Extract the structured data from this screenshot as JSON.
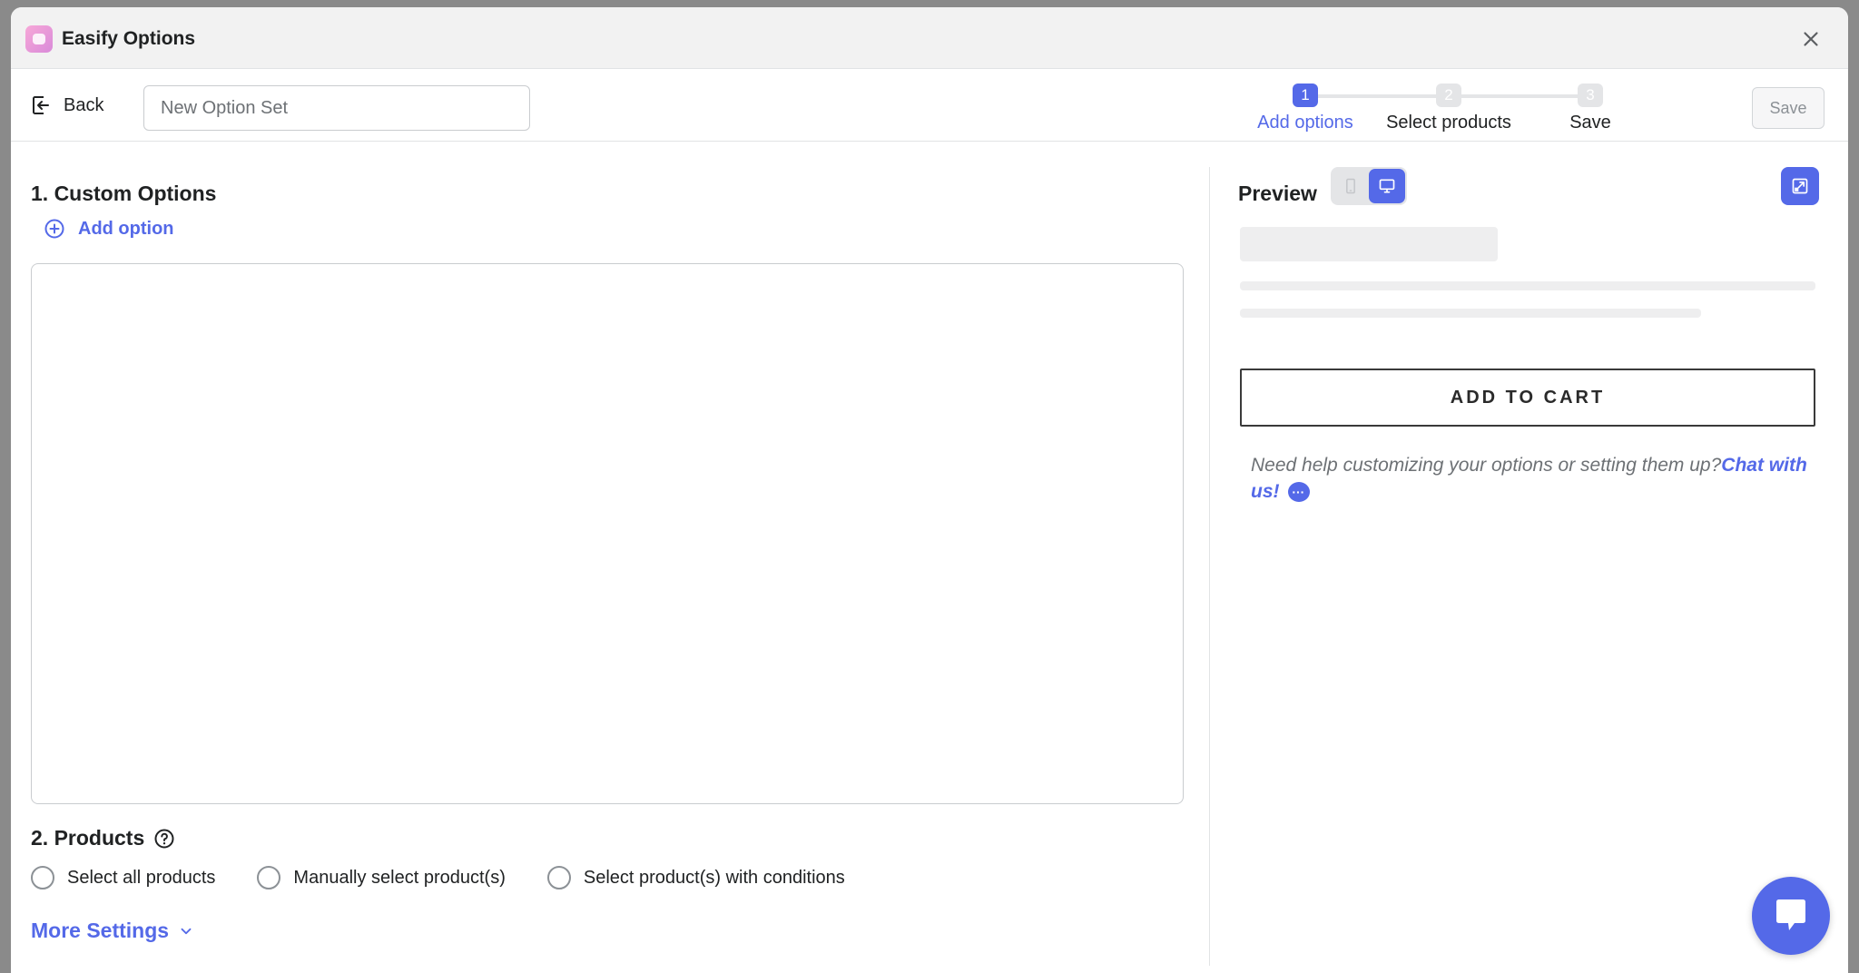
{
  "app": {
    "title": "Easify Options"
  },
  "header": {
    "back_label": "Back",
    "name_placeholder": "New Option Set",
    "save_label": "Save",
    "steps": [
      {
        "number": "1",
        "label": "Add options",
        "active": true
      },
      {
        "number": "2",
        "label": "Select products",
        "active": false
      },
      {
        "number": "3",
        "label": "Save",
        "active": false
      }
    ]
  },
  "custom_options": {
    "title": "1. Custom Options",
    "add_option_label": "Add option"
  },
  "products": {
    "title": "2. Products",
    "radios": [
      {
        "label": "Select all products",
        "selected": false
      },
      {
        "label": "Manually select product(s)",
        "selected": false
      },
      {
        "label": "Select product(s) with conditions",
        "selected": false
      }
    ],
    "more_settings_label": "More Settings"
  },
  "preview": {
    "title": "Preview",
    "device_selected": "desktop",
    "add_to_cart_label": "ADD TO CART",
    "help_text": "Need help customizing your options or setting them up?",
    "chat_link": "Chat with us!"
  },
  "colors": {
    "accent": "#5469e8",
    "text": "#202223",
    "muted": "#6d7175",
    "border": "#c9cccf"
  },
  "icons": {
    "close": "close-icon",
    "back": "back-arrow-icon",
    "add": "plus-circle-icon",
    "help": "question-circle-icon",
    "chevron": "chevron-down-icon",
    "mobile": "mobile-device-icon",
    "desktop": "desktop-monitor-icon",
    "expand": "expand-icon",
    "chat": "chat-bubble-icon"
  }
}
